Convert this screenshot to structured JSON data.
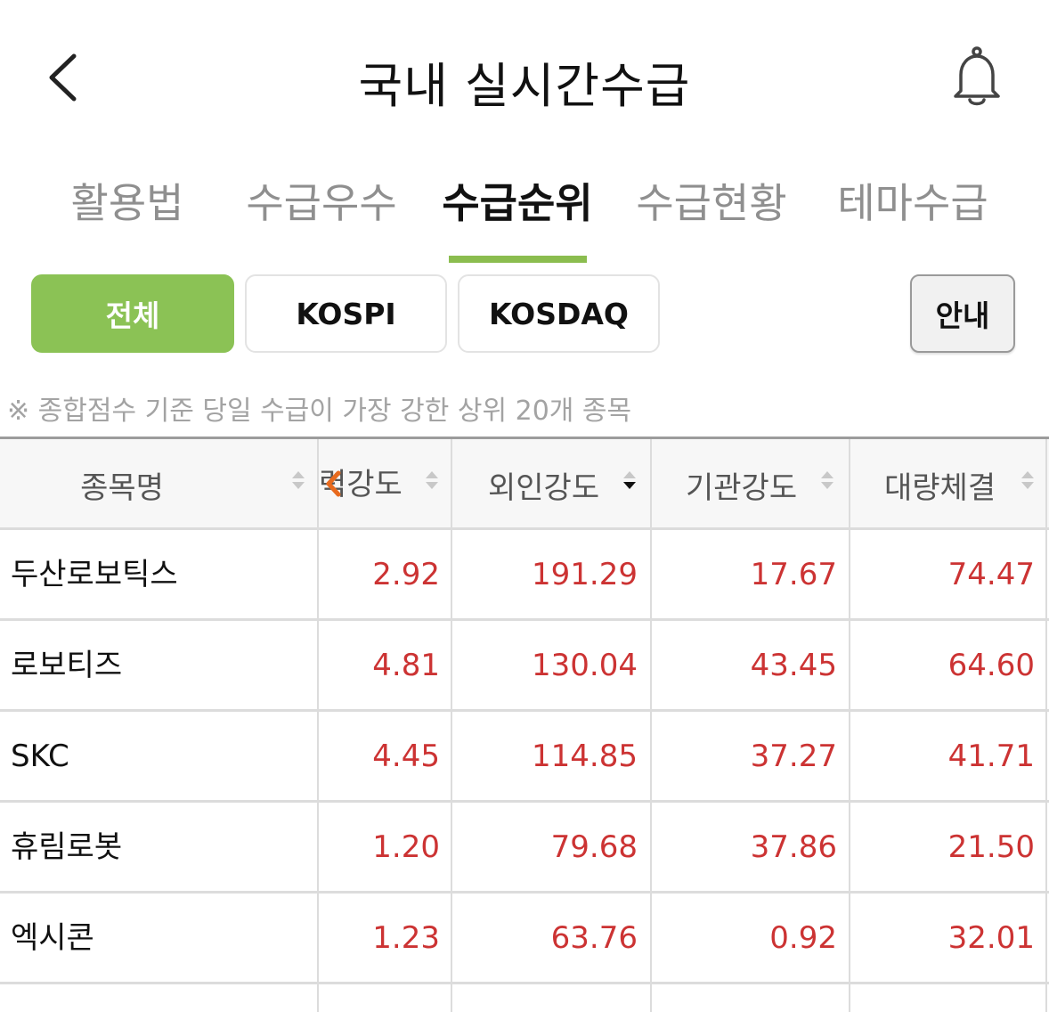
{
  "header": {
    "title": "국내 실시간수급",
    "back_icon": "chevron-left-icon",
    "bell_icon": "bell-icon"
  },
  "tabs": [
    {
      "label": "활용법",
      "active": false
    },
    {
      "label": "수급우수",
      "active": false
    },
    {
      "label": "수급순위",
      "active": true
    },
    {
      "label": "수급현황",
      "active": false
    },
    {
      "label": "테마수급",
      "active": false
    }
  ],
  "filters": {
    "items": [
      {
        "label": "전체",
        "active": true
      },
      {
        "label": "KOSPI",
        "active": false
      },
      {
        "label": "KOSDAQ",
        "active": false
      }
    ],
    "guide_label": "안내"
  },
  "notice": "※ 종합점수 기준 당일 수급이 가장 강한 상위 20개 종목",
  "table": {
    "headers": {
      "name": "종목명",
      "col1": "력강도",
      "col2": "외인강도",
      "col3": "기관강도",
      "col4": "대량체결"
    },
    "rows": [
      {
        "name": "두산로보틱스",
        "v1": "2.92",
        "v2": "191.29",
        "v3": "17.67",
        "v4": "74.47"
      },
      {
        "name": "로보티즈",
        "v1": "4.81",
        "v2": "130.04",
        "v3": "43.45",
        "v4": "64.60"
      },
      {
        "name": "SKC",
        "v1": "4.45",
        "v2": "114.85",
        "v3": "37.27",
        "v4": "41.71"
      },
      {
        "name": "휴림로봇",
        "v1": "1.20",
        "v2": "79.68",
        "v3": "37.86",
        "v4": "21.50"
      },
      {
        "name": "엑시콘",
        "v1": "1.23",
        "v2": "63.76",
        "v3": "0.92",
        "v4": "32.01"
      }
    ]
  },
  "colors": {
    "accent": "#8bc255",
    "tab_underline": "#8bbd4f",
    "value_red": "#cc3333",
    "scroll_hint": "#e86a1e"
  }
}
